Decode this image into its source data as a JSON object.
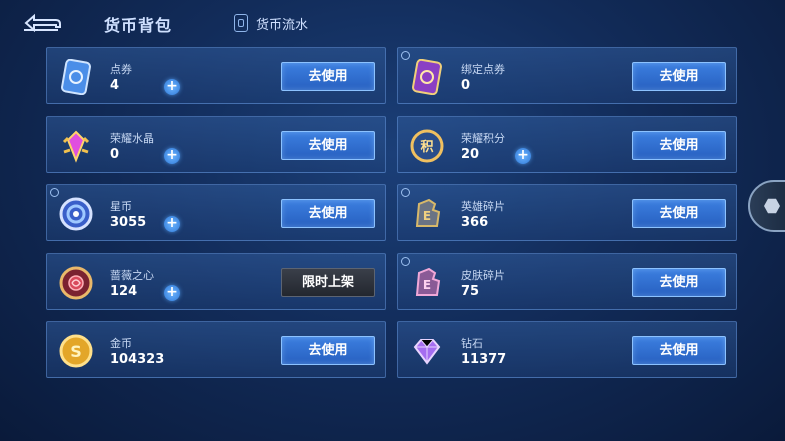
{
  "header": {
    "title": "货币背包",
    "flow_label": "货币流水"
  },
  "cards": [
    {
      "id": "dianquan",
      "name": "点券",
      "amount": "4",
      "has_plus": true,
      "button": "去使用",
      "dark": false,
      "icon": "voucher-icon",
      "corner": false
    },
    {
      "id": "bangding",
      "name": "绑定点券",
      "amount": "0",
      "has_plus": false,
      "button": "去使用",
      "dark": false,
      "icon": "bound-voucher-icon",
      "corner": true
    },
    {
      "id": "shuijing",
      "name": "荣耀水晶",
      "amount": "0",
      "has_plus": true,
      "button": "去使用",
      "dark": false,
      "icon": "crystal-icon",
      "corner": false
    },
    {
      "id": "jifen",
      "name": "荣耀积分",
      "amount": "20",
      "has_plus": true,
      "button": "去使用",
      "dark": false,
      "icon": "points-icon",
      "corner": false
    },
    {
      "id": "xingbi",
      "name": "星币",
      "amount": "3055",
      "has_plus": true,
      "button": "去使用",
      "dark": false,
      "icon": "star-coin-icon",
      "corner": true
    },
    {
      "id": "yingxiong",
      "name": "英雄碎片",
      "amount": "366",
      "has_plus": false,
      "button": "去使用",
      "dark": false,
      "icon": "hero-fragment-icon",
      "corner": true
    },
    {
      "id": "qiangwei",
      "name": "蔷薇之心",
      "amount": "124",
      "has_plus": true,
      "button": "限时上架",
      "dark": true,
      "icon": "rose-heart-icon",
      "corner": false
    },
    {
      "id": "pifu",
      "name": "皮肤碎片",
      "amount": "75",
      "has_plus": false,
      "button": "去使用",
      "dark": false,
      "icon": "skin-fragment-icon",
      "corner": true
    },
    {
      "id": "jinbi",
      "name": "金币",
      "amount": "104323",
      "has_plus": false,
      "button": "去使用",
      "dark": false,
      "icon": "gold-coin-icon",
      "corner": false
    },
    {
      "id": "zuanshi",
      "name": "钻石",
      "amount": "11377",
      "has_plus": false,
      "button": "去使用",
      "dark": false,
      "icon": "diamond-icon",
      "corner": false
    }
  ]
}
